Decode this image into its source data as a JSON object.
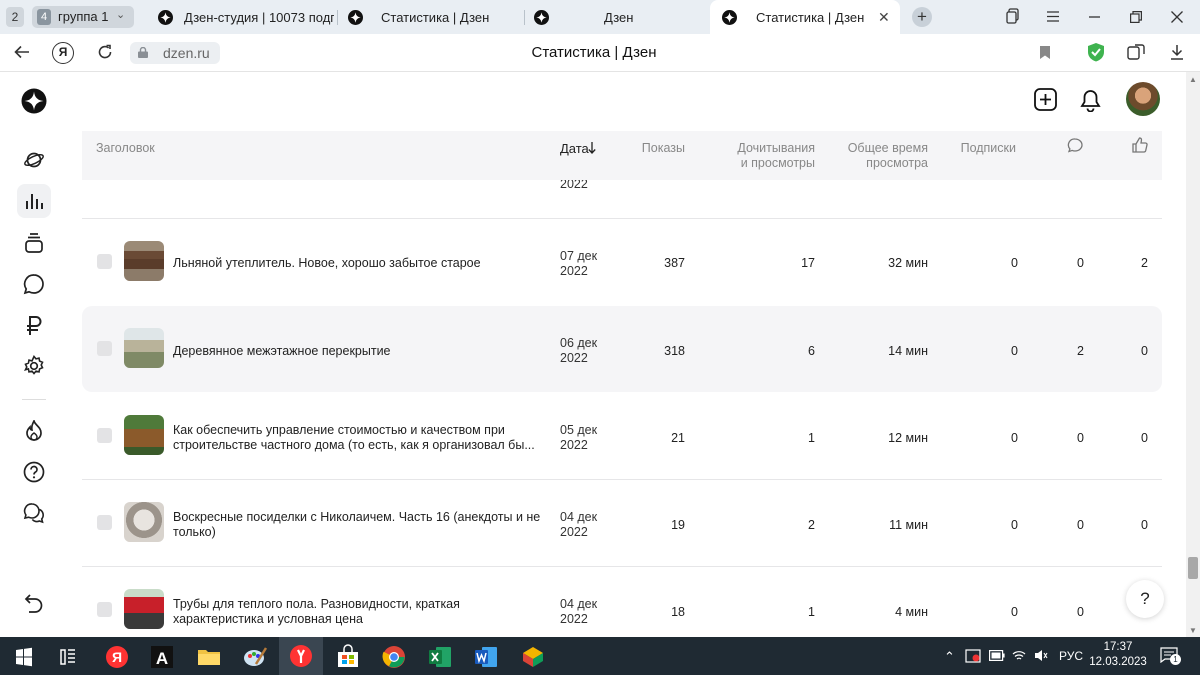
{
  "browser": {
    "group_count": "2",
    "group": {
      "count": "4",
      "label": "группа 1"
    },
    "tabs": [
      {
        "label": "Дзен-студия | 10073 подп"
      },
      {
        "label": "Статистика | Дзен"
      },
      {
        "label": "Дзен"
      },
      {
        "label": "Статистика | Дзен",
        "active": true
      }
    ],
    "url": "dzen.ru",
    "page_title": "Статистика | Дзен"
  },
  "sidebar": {
    "items": [
      {
        "icon": "dzen-logo-icon"
      },
      {
        "icon": "planet-icon"
      },
      {
        "icon": "stats-icon",
        "active": true
      },
      {
        "icon": "layers-icon"
      },
      {
        "icon": "comment-icon"
      },
      {
        "icon": "ruble-icon"
      },
      {
        "icon": "settings-icon"
      },
      {
        "icon": "fire-icon"
      },
      {
        "icon": "help-icon"
      },
      {
        "icon": "chat-icon"
      },
      {
        "icon": "undo-icon"
      }
    ]
  },
  "table": {
    "headers": {
      "title": "Заголовок",
      "date": "Дата",
      "views": "Показы",
      "reads_1": "Дочитывания",
      "reads_2": "и просмотры",
      "time_1": "Общее время",
      "time_2": "просмотра",
      "subs": "Подписки"
    },
    "partial_row": {
      "date": "2022"
    },
    "rows": [
      {
        "title": "Льняной утеплитель. Новое, хорошо забытое старое",
        "date_1": "07 дек",
        "date_2": "2022",
        "views": "387",
        "reads": "17",
        "time": "32 мин",
        "subs": "0",
        "comments": "0",
        "likes": "2"
      },
      {
        "title": "Деревянное межэтажное перекрытие",
        "date_1": "06 дек",
        "date_2": "2022",
        "views": "318",
        "reads": "6",
        "time": "14 мин",
        "subs": "0",
        "comments": "2",
        "likes": "0"
      },
      {
        "title": "Как обеспечить управление стоимостью и качеством при строительстве частного дома (то есть, как я организовал бы...",
        "date_1": "05 дек",
        "date_2": "2022",
        "views": "21",
        "reads": "1",
        "time": "12 мин",
        "subs": "0",
        "comments": "0",
        "likes": "0"
      },
      {
        "title": "Воскресные посиделки с Николаичем. Часть 16 (анекдоты и не только)",
        "date_1": "04 дек",
        "date_2": "2022",
        "views": "19",
        "reads": "2",
        "time": "11 мин",
        "subs": "0",
        "comments": "0",
        "likes": "0"
      },
      {
        "title": "Трубы для теплого пола. Разновидности, краткая характеристика и условная цена",
        "date_1": "04 дек",
        "date_2": "2022",
        "views": "18",
        "reads": "1",
        "time": "4 мин",
        "subs": "0",
        "comments": "0",
        "likes": ""
      }
    ]
  },
  "help_label": "?",
  "taskbar": {
    "lang": "РУС",
    "time": "17:37",
    "date": "12.03.2023",
    "notif_count": "1"
  }
}
